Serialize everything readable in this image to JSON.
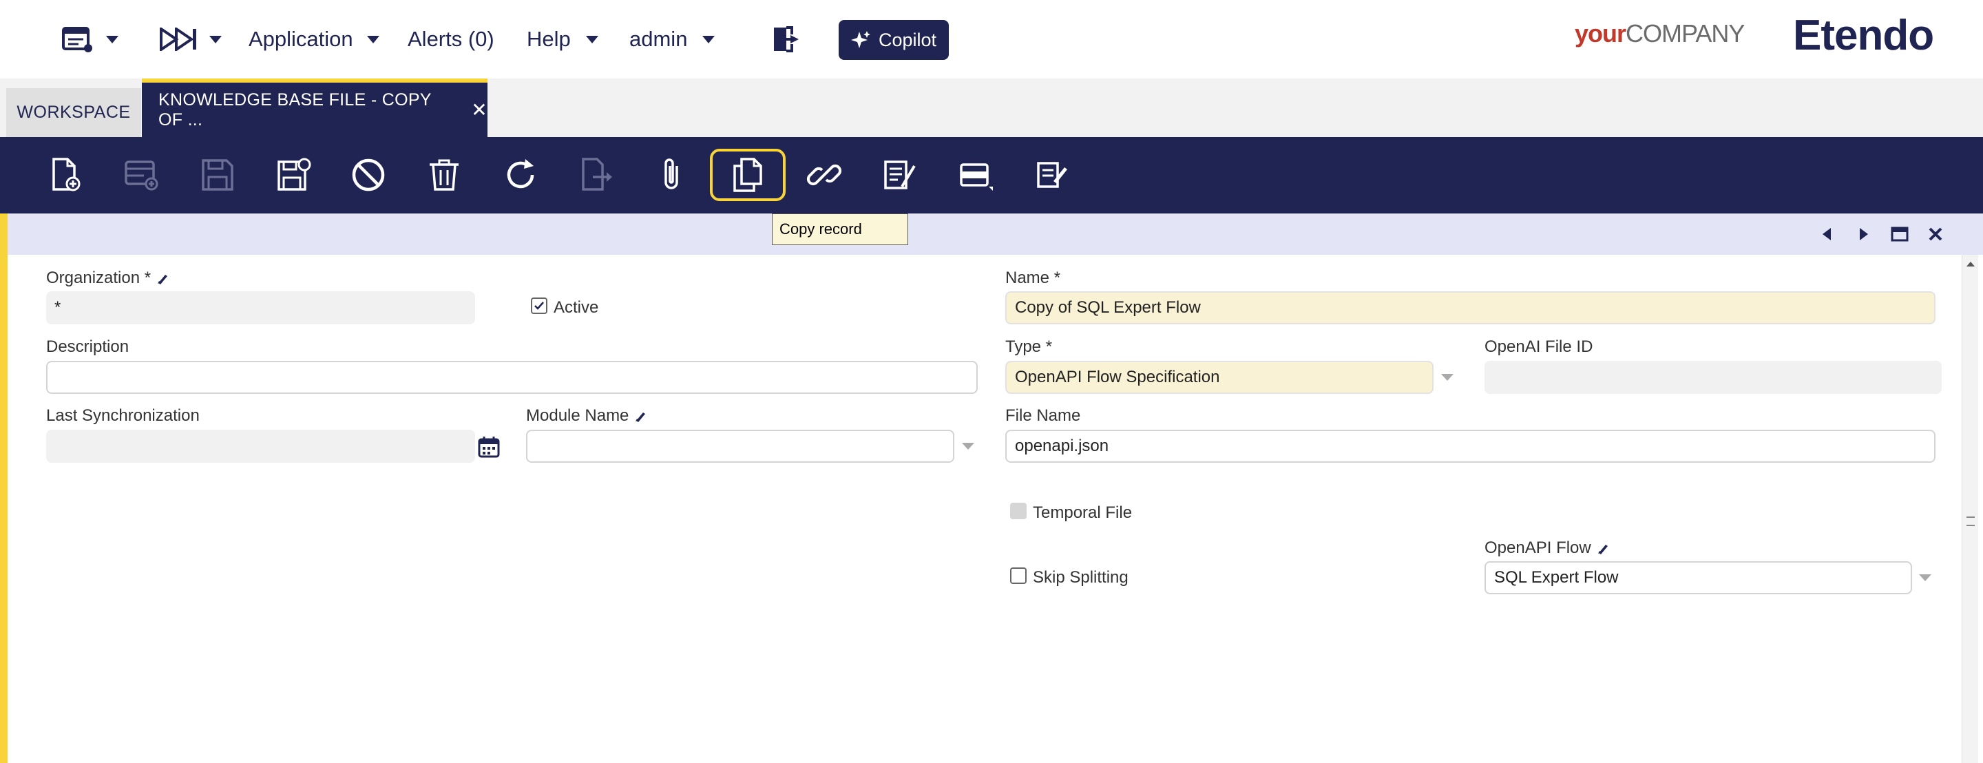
{
  "nav": {
    "application": "Application",
    "alerts": "Alerts (0)",
    "help": "Help",
    "user": "admin",
    "copilot": "Copilot"
  },
  "brand": {
    "your": "your",
    "company": "COMPANY",
    "product": "Etendo"
  },
  "tabs": {
    "workspace": "WORKSPACE",
    "active": "KNOWLEDGE BASE FILE - COPY OF ..."
  },
  "toolbar": {
    "tooltip": "Copy record",
    "buttons": [
      "new-document",
      "new-row",
      "save",
      "save-close",
      "undo",
      "delete",
      "refresh",
      "export",
      "attachment",
      "copy-record",
      "link",
      "audit",
      "grid-view",
      "notes"
    ]
  },
  "form": {
    "organization": {
      "label": "Organization *",
      "value": "*"
    },
    "active": {
      "label": "Active",
      "checked": true
    },
    "name": {
      "label": "Name *",
      "value": "Copy of SQL Expert Flow"
    },
    "description": {
      "label": "Description",
      "value": ""
    },
    "type": {
      "label": "Type *",
      "value": "OpenAPI Flow Specification"
    },
    "openai_file_id": {
      "label": "OpenAI File ID",
      "value": ""
    },
    "last_sync": {
      "label": "Last Synchronization",
      "value": ""
    },
    "module_name": {
      "label": "Module Name",
      "value": ""
    },
    "file_name": {
      "label": "File Name",
      "value": "openapi.json"
    },
    "temporal_file": {
      "label": "Temporal File",
      "checked": false
    },
    "skip_splitting": {
      "label": "Skip Splitting",
      "checked": false
    },
    "openapi_flow": {
      "label": "OpenAPI Flow",
      "value": "SQL Expert Flow"
    }
  },
  "colors": {
    "navy": "#202452",
    "accent": "#f8d33a",
    "required_bg": "#f9f2d4"
  }
}
